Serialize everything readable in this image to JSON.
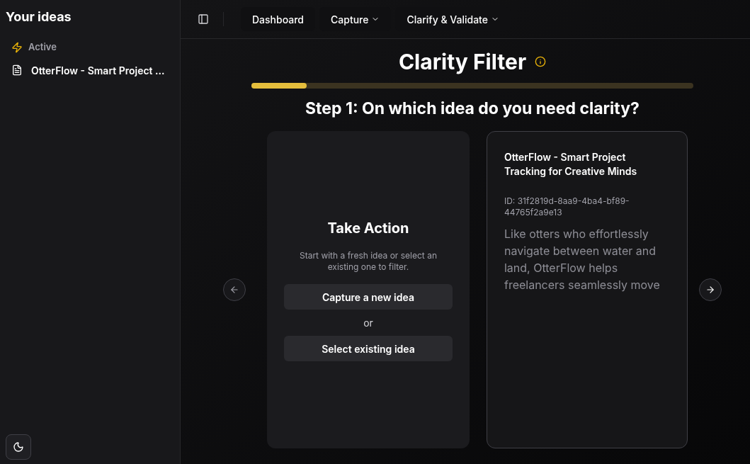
{
  "sidebar": {
    "title": "Your ideas",
    "section": {
      "label": "Active"
    },
    "items": [
      {
        "label": "OtterFlow - Smart Project ...",
        "selected": false
      }
    ]
  },
  "nav": [
    {
      "label": "Dashboard",
      "dropdown": false
    },
    {
      "label": "Capture",
      "dropdown": true
    },
    {
      "label": "Clarify & Validate",
      "dropdown": true
    }
  ],
  "page": {
    "title": "Clarity Filter",
    "progress": {
      "level": 0.125
    },
    "step_title": "Step 1: On which idea do you need clarity?"
  },
  "action_card": {
    "title": "Take Action",
    "text": "Start with a fresh idea or select an existing one to filter.",
    "buttons": [
      "Capture a new idea",
      "Select existing idea"
    ],
    "separator": "or"
  },
  "idea_card": {
    "title": "OtterFlow - Smart Project Tracking for Creative Minds",
    "id": "ID: 31f2819d-8aa9-4ba4-bf89-44765f2a9e13",
    "description": "Like otters who effortlessly navigate between water and land, OtterFlow helps freelancers seamlessly move"
  }
}
